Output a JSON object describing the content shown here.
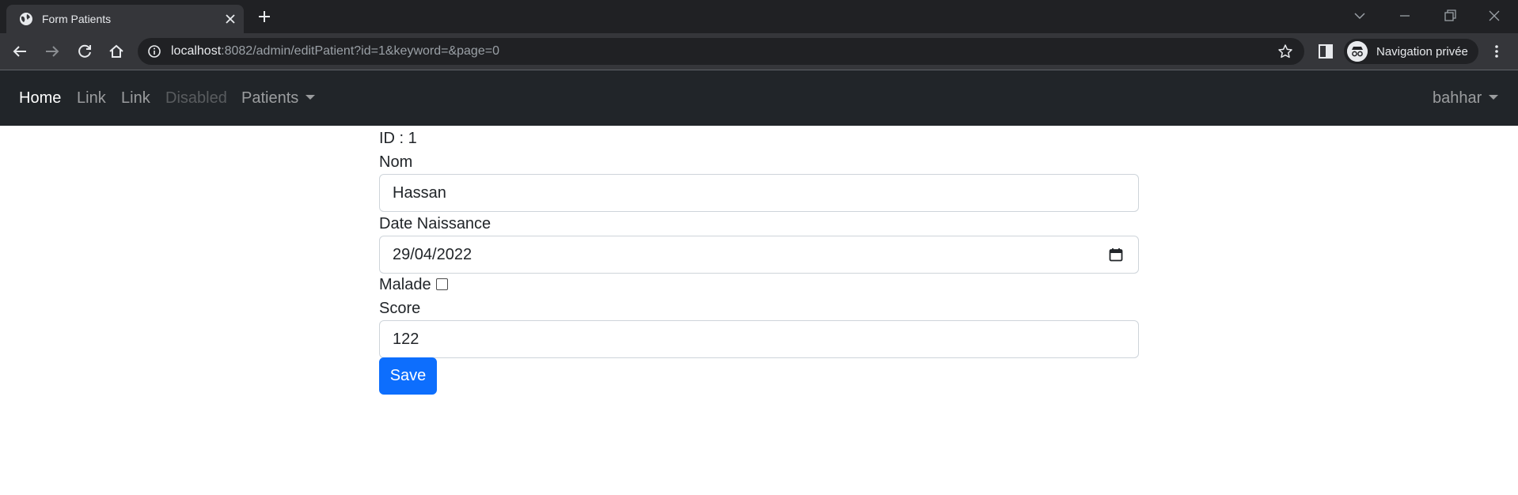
{
  "browser": {
    "tab_title": "Form Patients",
    "url_host": "localhost",
    "url_rest": ":8082/admin/editPatient?id=1&keyword=&page=0",
    "profile_label": "Navigation privée"
  },
  "navbar": {
    "items": [
      {
        "label": "Home",
        "state": "active"
      },
      {
        "label": "Link",
        "state": "normal"
      },
      {
        "label": "Link",
        "state": "normal"
      },
      {
        "label": "Disabled",
        "state": "disabled"
      },
      {
        "label": "Patients",
        "state": "dropdown"
      }
    ],
    "user_menu": "bahhar"
  },
  "form": {
    "id_text": "ID : 1",
    "nom_label": "Nom",
    "nom_value": "Hassan",
    "date_label": "Date Naissance",
    "date_value": "29/04/2022",
    "malade_label": "Malade",
    "malade_checked": false,
    "score_label": "Score",
    "score_value": "122",
    "save_label": "Save"
  },
  "colors": {
    "navbar_bg": "#212529",
    "primary": "#0d6efd",
    "chrome_dark": "#202124",
    "chrome_toolbar": "#35363a"
  },
  "icons": [
    "globe-icon",
    "close-icon",
    "plus-icon",
    "chevron-down-icon",
    "minimize-icon",
    "restore-icon",
    "back-icon",
    "forward-icon",
    "reload-icon",
    "home-icon",
    "info-icon",
    "star-icon",
    "side-panel-icon",
    "incognito-icon",
    "kebab-menu-icon",
    "calendar-icon"
  ]
}
